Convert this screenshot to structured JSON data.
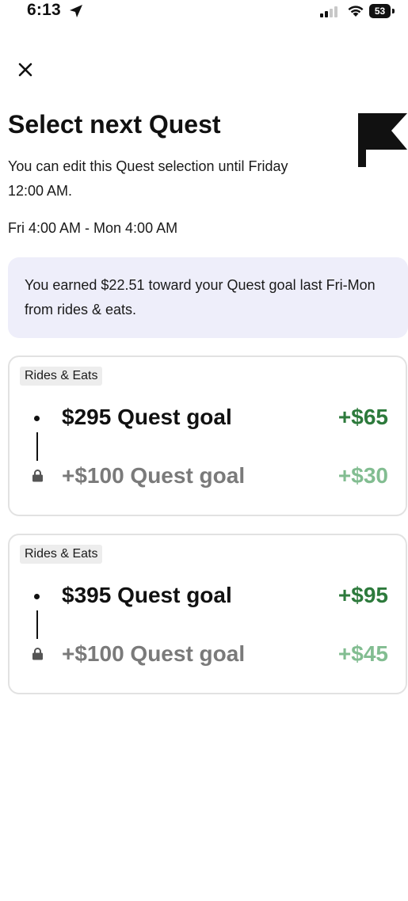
{
  "status_bar": {
    "time": "6:13",
    "battery": "53"
  },
  "header": {
    "title": "Select next Quest",
    "edit_note": "You can edit this Quest selection until Friday 12:00 AM.",
    "time_range": "Fri 4:00 AM - Mon 4:00 AM"
  },
  "banner": {
    "text": "You earned $22.51 toward your Quest goal last Fri-Mon from rides & eats."
  },
  "quests": [
    {
      "category": "Rides & Eats",
      "goal": "$295 Quest goal",
      "reward": "+$65",
      "bonus_goal": "+$100 Quest goal",
      "bonus_reward": "+$30"
    },
    {
      "category": "Rides & Eats",
      "goal": "$395 Quest goal",
      "reward": "+$95",
      "bonus_goal": "+$100 Quest goal",
      "bonus_reward": "+$45"
    }
  ],
  "colors": {
    "reward_green": "#2d7a3c",
    "bonus_green": "#82bd91",
    "banner_bg": "#eeeefa",
    "tag_bg": "#ededed"
  },
  "icons": {
    "close": "close-icon",
    "flag": "flag-icon",
    "lock": "lock-icon",
    "location": "location-arrow-icon"
  }
}
